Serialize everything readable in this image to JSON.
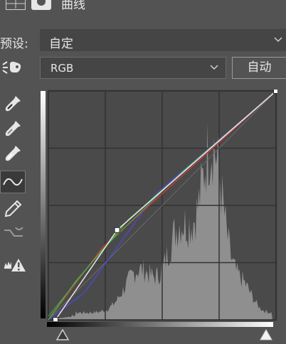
{
  "header": {
    "title": "曲线",
    "layout_icon": "grid-icon",
    "mask_icon": "mask-icon"
  },
  "preset": {
    "label": "预设:",
    "value": "自定"
  },
  "channel": {
    "value": "RGB"
  },
  "auto_button": {
    "label": "自动"
  },
  "tools": [
    {
      "name": "on-image-adjust-icon"
    },
    {
      "name": "black-point-eyedropper-icon"
    },
    {
      "name": "gray-point-eyedropper-icon"
    },
    {
      "name": "white-point-eyedropper-icon"
    },
    {
      "name": "curve-edit-icon",
      "active": true
    },
    {
      "name": "pencil-icon"
    },
    {
      "name": "smooth-curve-icon"
    },
    {
      "name": "clipping-warning-icon"
    }
  ],
  "curves": {
    "rgb_points": [
      {
        "input": 8,
        "output": 0
      },
      {
        "input": 77,
        "output": 100
      },
      {
        "input": 255,
        "output": 255
      }
    ],
    "colors": {
      "red": "#c23a3a",
      "green": "#4aa84a",
      "blue": "#4a4ac8",
      "composite": "#e8e8e8"
    }
  },
  "colors": {
    "panel_bg": "#535353",
    "field_bg": "#454545",
    "graph_bg": "#4a4a4a",
    "histogram": "#8f8f8f"
  }
}
